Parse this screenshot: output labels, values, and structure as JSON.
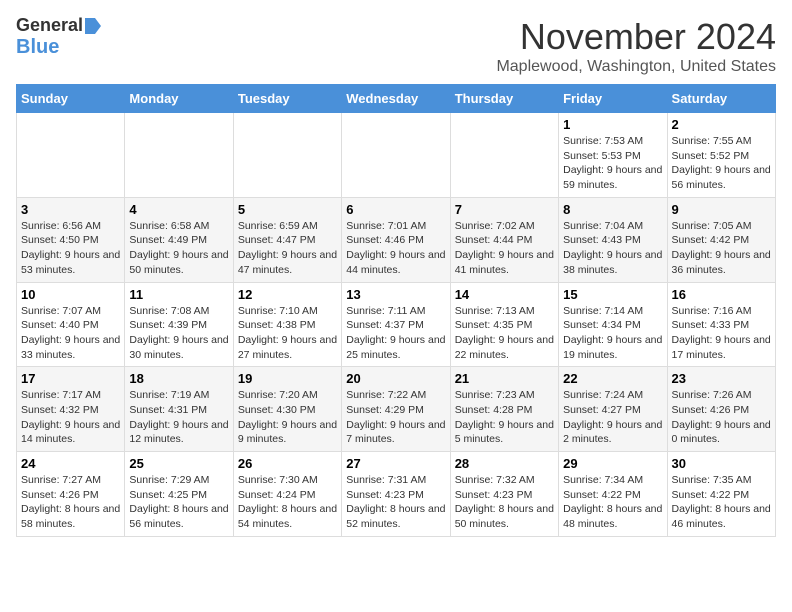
{
  "logo": {
    "line1": "General",
    "line2": "Blue"
  },
  "header": {
    "month": "November 2024",
    "location": "Maplewood, Washington, United States"
  },
  "days_of_week": [
    "Sunday",
    "Monday",
    "Tuesday",
    "Wednesday",
    "Thursday",
    "Friday",
    "Saturday"
  ],
  "weeks": [
    [
      {
        "day": "",
        "info": ""
      },
      {
        "day": "",
        "info": ""
      },
      {
        "day": "",
        "info": ""
      },
      {
        "day": "",
        "info": ""
      },
      {
        "day": "",
        "info": ""
      },
      {
        "day": "1",
        "info": "Sunrise: 7:53 AM\nSunset: 5:53 PM\nDaylight: 9 hours and 59 minutes."
      },
      {
        "day": "2",
        "info": "Sunrise: 7:55 AM\nSunset: 5:52 PM\nDaylight: 9 hours and 56 minutes."
      }
    ],
    [
      {
        "day": "3",
        "info": "Sunrise: 6:56 AM\nSunset: 4:50 PM\nDaylight: 9 hours and 53 minutes."
      },
      {
        "day": "4",
        "info": "Sunrise: 6:58 AM\nSunset: 4:49 PM\nDaylight: 9 hours and 50 minutes."
      },
      {
        "day": "5",
        "info": "Sunrise: 6:59 AM\nSunset: 4:47 PM\nDaylight: 9 hours and 47 minutes."
      },
      {
        "day": "6",
        "info": "Sunrise: 7:01 AM\nSunset: 4:46 PM\nDaylight: 9 hours and 44 minutes."
      },
      {
        "day": "7",
        "info": "Sunrise: 7:02 AM\nSunset: 4:44 PM\nDaylight: 9 hours and 41 minutes."
      },
      {
        "day": "8",
        "info": "Sunrise: 7:04 AM\nSunset: 4:43 PM\nDaylight: 9 hours and 38 minutes."
      },
      {
        "day": "9",
        "info": "Sunrise: 7:05 AM\nSunset: 4:42 PM\nDaylight: 9 hours and 36 minutes."
      }
    ],
    [
      {
        "day": "10",
        "info": "Sunrise: 7:07 AM\nSunset: 4:40 PM\nDaylight: 9 hours and 33 minutes."
      },
      {
        "day": "11",
        "info": "Sunrise: 7:08 AM\nSunset: 4:39 PM\nDaylight: 9 hours and 30 minutes."
      },
      {
        "day": "12",
        "info": "Sunrise: 7:10 AM\nSunset: 4:38 PM\nDaylight: 9 hours and 27 minutes."
      },
      {
        "day": "13",
        "info": "Sunrise: 7:11 AM\nSunset: 4:37 PM\nDaylight: 9 hours and 25 minutes."
      },
      {
        "day": "14",
        "info": "Sunrise: 7:13 AM\nSunset: 4:35 PM\nDaylight: 9 hours and 22 minutes."
      },
      {
        "day": "15",
        "info": "Sunrise: 7:14 AM\nSunset: 4:34 PM\nDaylight: 9 hours and 19 minutes."
      },
      {
        "day": "16",
        "info": "Sunrise: 7:16 AM\nSunset: 4:33 PM\nDaylight: 9 hours and 17 minutes."
      }
    ],
    [
      {
        "day": "17",
        "info": "Sunrise: 7:17 AM\nSunset: 4:32 PM\nDaylight: 9 hours and 14 minutes."
      },
      {
        "day": "18",
        "info": "Sunrise: 7:19 AM\nSunset: 4:31 PM\nDaylight: 9 hours and 12 minutes."
      },
      {
        "day": "19",
        "info": "Sunrise: 7:20 AM\nSunset: 4:30 PM\nDaylight: 9 hours and 9 minutes."
      },
      {
        "day": "20",
        "info": "Sunrise: 7:22 AM\nSunset: 4:29 PM\nDaylight: 9 hours and 7 minutes."
      },
      {
        "day": "21",
        "info": "Sunrise: 7:23 AM\nSunset: 4:28 PM\nDaylight: 9 hours and 5 minutes."
      },
      {
        "day": "22",
        "info": "Sunrise: 7:24 AM\nSunset: 4:27 PM\nDaylight: 9 hours and 2 minutes."
      },
      {
        "day": "23",
        "info": "Sunrise: 7:26 AM\nSunset: 4:26 PM\nDaylight: 9 hours and 0 minutes."
      }
    ],
    [
      {
        "day": "24",
        "info": "Sunrise: 7:27 AM\nSunset: 4:26 PM\nDaylight: 8 hours and 58 minutes."
      },
      {
        "day": "25",
        "info": "Sunrise: 7:29 AM\nSunset: 4:25 PM\nDaylight: 8 hours and 56 minutes."
      },
      {
        "day": "26",
        "info": "Sunrise: 7:30 AM\nSunset: 4:24 PM\nDaylight: 8 hours and 54 minutes."
      },
      {
        "day": "27",
        "info": "Sunrise: 7:31 AM\nSunset: 4:23 PM\nDaylight: 8 hours and 52 minutes."
      },
      {
        "day": "28",
        "info": "Sunrise: 7:32 AM\nSunset: 4:23 PM\nDaylight: 8 hours and 50 minutes."
      },
      {
        "day": "29",
        "info": "Sunrise: 7:34 AM\nSunset: 4:22 PM\nDaylight: 8 hours and 48 minutes."
      },
      {
        "day": "30",
        "info": "Sunrise: 7:35 AM\nSunset: 4:22 PM\nDaylight: 8 hours and 46 minutes."
      }
    ]
  ]
}
